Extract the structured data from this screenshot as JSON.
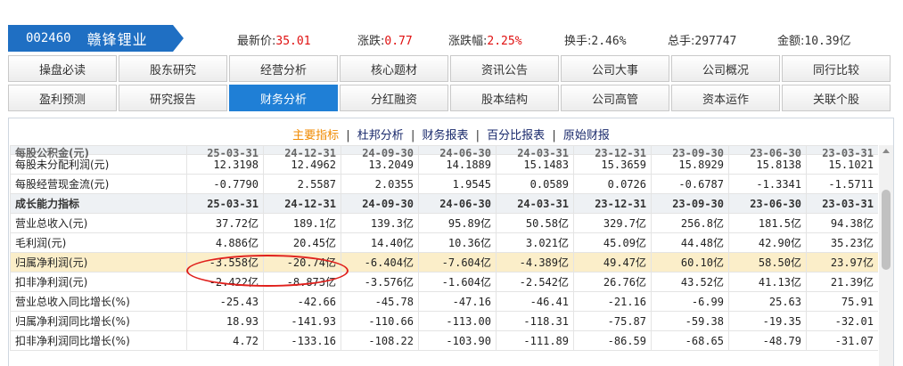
{
  "stock": {
    "code": "002460",
    "name": "赣锋锂业"
  },
  "quote": {
    "last_label": "最新价:",
    "last_value": "35.01",
    "change_label": "涨跌:",
    "change_value": "0.77",
    "pct_label": "涨跌幅:",
    "pct_value": "2.25%",
    "turnover_label": "换手:",
    "turnover_value": "2.46%",
    "volume_label": "总手:",
    "volume_value": "297747",
    "amount_label": "金额:",
    "amount_value": "10.39亿"
  },
  "nav": {
    "row1": [
      "操盘必读",
      "股东研究",
      "经营分析",
      "核心题材",
      "资讯公告",
      "公司大事",
      "公司概况",
      "同行比较"
    ],
    "row2": [
      "盈利预测",
      "研究报告",
      "财务分析",
      "分红融资",
      "股本结构",
      "公司高管",
      "资本运作",
      "关联个股"
    ],
    "active": "财务分析"
  },
  "subtabs": {
    "t1": "主要指标",
    "t2": "杜邦分析",
    "t3": "财务报表",
    "t4": "百分比报表",
    "t5": "原始财报",
    "sep": "|"
  },
  "table": {
    "rows": [
      {
        "label": "每股公积金(元)",
        "cells": [
          "25-03-31",
          "24-12-31",
          "24-09-30",
          "24-06-30",
          "24-03-31",
          "23-12-31",
          "23-09-30",
          "23-06-30",
          "23-03-31"
        ]
      },
      {
        "label": "每股未分配利润(元)",
        "cells": [
          "12.3198",
          "12.4962",
          "13.2049",
          "14.1889",
          "15.1483",
          "15.3659",
          "15.8929",
          "15.8138",
          "15.1021"
        ]
      },
      {
        "label": "每股经营现金流(元)",
        "cells": [
          "-0.7790",
          "2.5587",
          "2.0355",
          "1.9545",
          "0.0589",
          "0.0726",
          "-0.6787",
          "-1.3341",
          "-1.5711"
        ]
      },
      {
        "label": "成长能力指标",
        "cells": [
          "25-03-31",
          "24-12-31",
          "24-09-30",
          "24-06-30",
          "24-03-31",
          "23-12-31",
          "23-09-30",
          "23-06-30",
          "23-03-31"
        ]
      },
      {
        "label": "营业总收入(元)",
        "cells": [
          "37.72亿",
          "189.1亿",
          "139.3亿",
          "95.89亿",
          "50.58亿",
          "329.7亿",
          "256.8亿",
          "181.5亿",
          "94.38亿"
        ]
      },
      {
        "label": "毛利润(元)",
        "cells": [
          "4.886亿",
          "20.45亿",
          "14.40亿",
          "10.36亿",
          "3.021亿",
          "45.09亿",
          "44.48亿",
          "42.90亿",
          "35.23亿"
        ]
      },
      {
        "label": "归属净利润(元)",
        "cells": [
          "-3.558亿",
          "-20.74亿",
          "-6.404亿",
          "-7.604亿",
          "-4.389亿",
          "49.47亿",
          "60.10亿",
          "58.50亿",
          "23.97亿"
        ]
      },
      {
        "label": "扣非净利润(元)",
        "cells": [
          "-2.422亿",
          "-8.873亿",
          "-3.576亿",
          "-1.604亿",
          "-2.542亿",
          "26.76亿",
          "43.52亿",
          "41.13亿",
          "21.39亿"
        ]
      },
      {
        "label": "营业总收入同比增长(%)",
        "cells": [
          "-25.43",
          "-42.66",
          "-45.78",
          "-47.16",
          "-46.41",
          "-21.16",
          "-6.99",
          "25.63",
          "75.91"
        ]
      },
      {
        "label": "归属净利润同比增长(%)",
        "cells": [
          "18.93",
          "-141.93",
          "-110.66",
          "-113.00",
          "-118.31",
          "-75.87",
          "-59.38",
          "-19.35",
          "-32.01"
        ]
      },
      {
        "label": "扣非净利润同比增长(%)",
        "cells": [
          "4.72",
          "-133.16",
          "-108.22",
          "-103.90",
          "-111.89",
          "-86.59",
          "-68.65",
          "-48.79",
          "-31.07"
        ]
      }
    ]
  }
}
